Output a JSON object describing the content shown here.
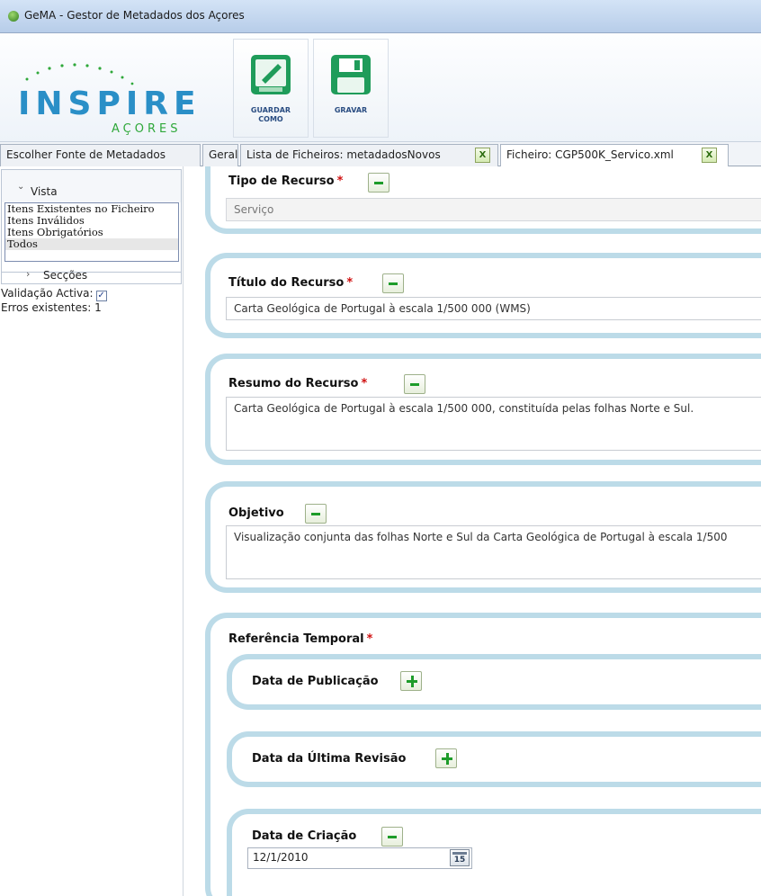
{
  "window": {
    "title": "GeMA - Gestor de Metadados dos Açores"
  },
  "ribbon": {
    "logo_main": "INSPIRE",
    "logo_sub": "AÇORES",
    "save_as_label_1": "GUARDAR",
    "save_as_label_2": "COMO",
    "save_label": "GRAVAR"
  },
  "tabs": [
    {
      "label": "Escolher Fonte de Metadados"
    },
    {
      "label": "Geral"
    },
    {
      "label": "Lista de Ficheiros: metadadosNovos",
      "close": "X"
    },
    {
      "label": "Ficheiro: CGP500K_Servico.xml",
      "close": "X"
    }
  ],
  "sidebar": {
    "vista_label": "Vista",
    "vista_items": [
      "Itens Existentes no Ficheiro",
      "Itens Inválidos",
      "Itens Obrigatórios",
      "Todos"
    ],
    "selected_item": "Todos",
    "seccoes_label": "Secções",
    "validation_label": "Validação Activa:",
    "validation_checked": true,
    "check_mark": "✓",
    "errors_label": "Erros existentes: 1"
  },
  "required_mark": "*",
  "sections": {
    "tipo": {
      "title": "Tipo de Recurso",
      "value": "Serviço"
    },
    "titulo": {
      "title": "Título do Recurso",
      "value": "Carta Geológica de Portugal à escala 1/500 000 (WMS)"
    },
    "resumo": {
      "title": "Resumo do Recurso",
      "value": "Carta Geológica de Portugal à escala 1/500 000, constituída pelas folhas Norte e Sul."
    },
    "objetivo": {
      "title": "Objetivo",
      "value": "Visualização conjunta das folhas Norte e Sul da Carta Geológica de Portugal à escala 1/500"
    },
    "referencia": {
      "title": "Referência Temporal",
      "publicacao": {
        "title": "Data de Publicação"
      },
      "revisao": {
        "title": "Data da Última Revisão"
      },
      "criacao": {
        "title": "Data de Criação",
        "value": "12/1/2010",
        "calendar_day": "15"
      }
    }
  },
  "colors": {
    "card_border": "#bcdbe8",
    "required": "#d01010",
    "action_green": "#1e9c2a",
    "ribbon_label": "#2a4d82"
  }
}
